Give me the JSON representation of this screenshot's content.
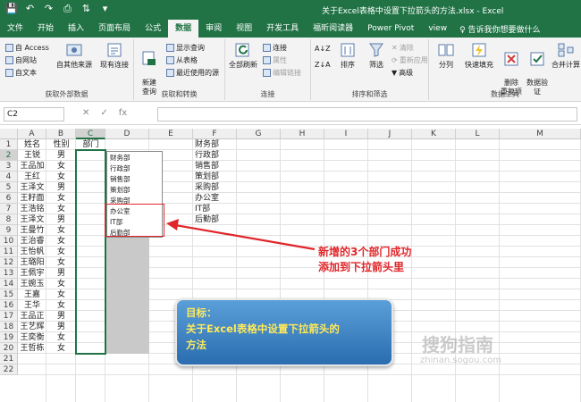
{
  "window": {
    "title": "关于Excel表格中设置下拉箭头的方法.xlsx - Excel",
    "qat": [
      "save-icon",
      "undo-icon",
      "redo-icon",
      "print-preview-icon",
      "sort-icon",
      "more-icon"
    ]
  },
  "menu": {
    "tabs": [
      "文件",
      "开始",
      "插入",
      "页面布局",
      "公式",
      "数据",
      "审阅",
      "视图",
      "开发工具",
      "福昕阅读器",
      "Power Pivot",
      "view"
    ],
    "active": "数据",
    "tell_me": "♀ 告诉我你想要做什么"
  },
  "ribbon": {
    "get_external": {
      "access": "自 Access",
      "web": "自网站",
      "text": "自文本",
      "other": "自其他来源",
      "existing": "现有连接",
      "label": "获取外部数据"
    },
    "transform": {
      "new_query": "新建\n查询",
      "show_queries": "显示查询",
      "from_table": "从表格",
      "recent": "最近使用的源",
      "label": "获取和转换"
    },
    "connections": {
      "refresh_all": "全部刷新",
      "connections": "连接",
      "properties": "属性",
      "edit_links": "编辑链接",
      "label": "连接"
    },
    "sort_filter": {
      "az": "A↓Z",
      "za": "Z↓A",
      "sort": "排序",
      "filter": "筛选",
      "clear": "清除",
      "reapply": "重新应用",
      "advanced": "高级",
      "label": "排序和筛选"
    },
    "data_tools": {
      "split": "分列",
      "flash": "快速填充",
      "dup": "删除\n重复项",
      "validate": "数据验\n证",
      "consolidate": "合并计算",
      "label": "数据工具"
    }
  },
  "formula_bar": {
    "name_box": "C2",
    "cancel": "✕",
    "enter": "✓",
    "fx": "fx",
    "value": ""
  },
  "columns": [
    "A",
    "B",
    "C",
    "D",
    "E",
    "F",
    "G",
    "H",
    "I",
    "J",
    "K",
    "L",
    "M"
  ],
  "rows": [
    "1",
    "2",
    "3",
    "4",
    "5",
    "6",
    "7",
    "8",
    "9",
    "10",
    "11",
    "12",
    "13",
    "14",
    "15",
    "16",
    "17",
    "18",
    "19",
    "20",
    "21",
    "22"
  ],
  "sheet": {
    "header": {
      "a": "姓名",
      "b": "性别",
      "c": "部门"
    },
    "names": [
      "王锐",
      "王品加",
      "王红",
      "王泽文",
      "王籽面",
      "王浩铭",
      "王泽文",
      "王曼竹",
      "王治睿",
      "王怡帆",
      "王璐阳",
      "王佩宇",
      "王婉玉",
      "王嘉",
      "王华",
      "王品正",
      "王艺辉",
      "王奕衡",
      "王哲栋"
    ],
    "genders": [
      "男",
      "女",
      "女",
      "男",
      "女",
      "女",
      "男",
      "女",
      "女",
      "女",
      "女",
      "男",
      "女",
      "女",
      "女",
      "男",
      "男",
      "女",
      "女"
    ],
    "departments": [
      "财务部",
      "行政部",
      "销售部",
      "策划部",
      "采购部",
      "办公室",
      "IT部",
      "后勤部"
    ]
  },
  "dropdown": {
    "items": [
      "财务部",
      "行政部",
      "销售部",
      "策划部",
      "采购部",
      "办公室",
      "IT部",
      "后勤部"
    ]
  },
  "annotation": {
    "line1": "新增的3个部门成功",
    "line2": "添加到下拉箭头里"
  },
  "note": {
    "line1": "目标：",
    "line2": "关于Excel表格中设置下拉箭头的",
    "line3": "方法"
  },
  "watermark": {
    "line1": "搜狗指南",
    "line2": "zhinan.sogou.com"
  },
  "colors": {
    "excel_green": "#217346",
    "red": "#e0262a",
    "note_blue": "#2a6db0",
    "note_text": "#ffe95a"
  }
}
